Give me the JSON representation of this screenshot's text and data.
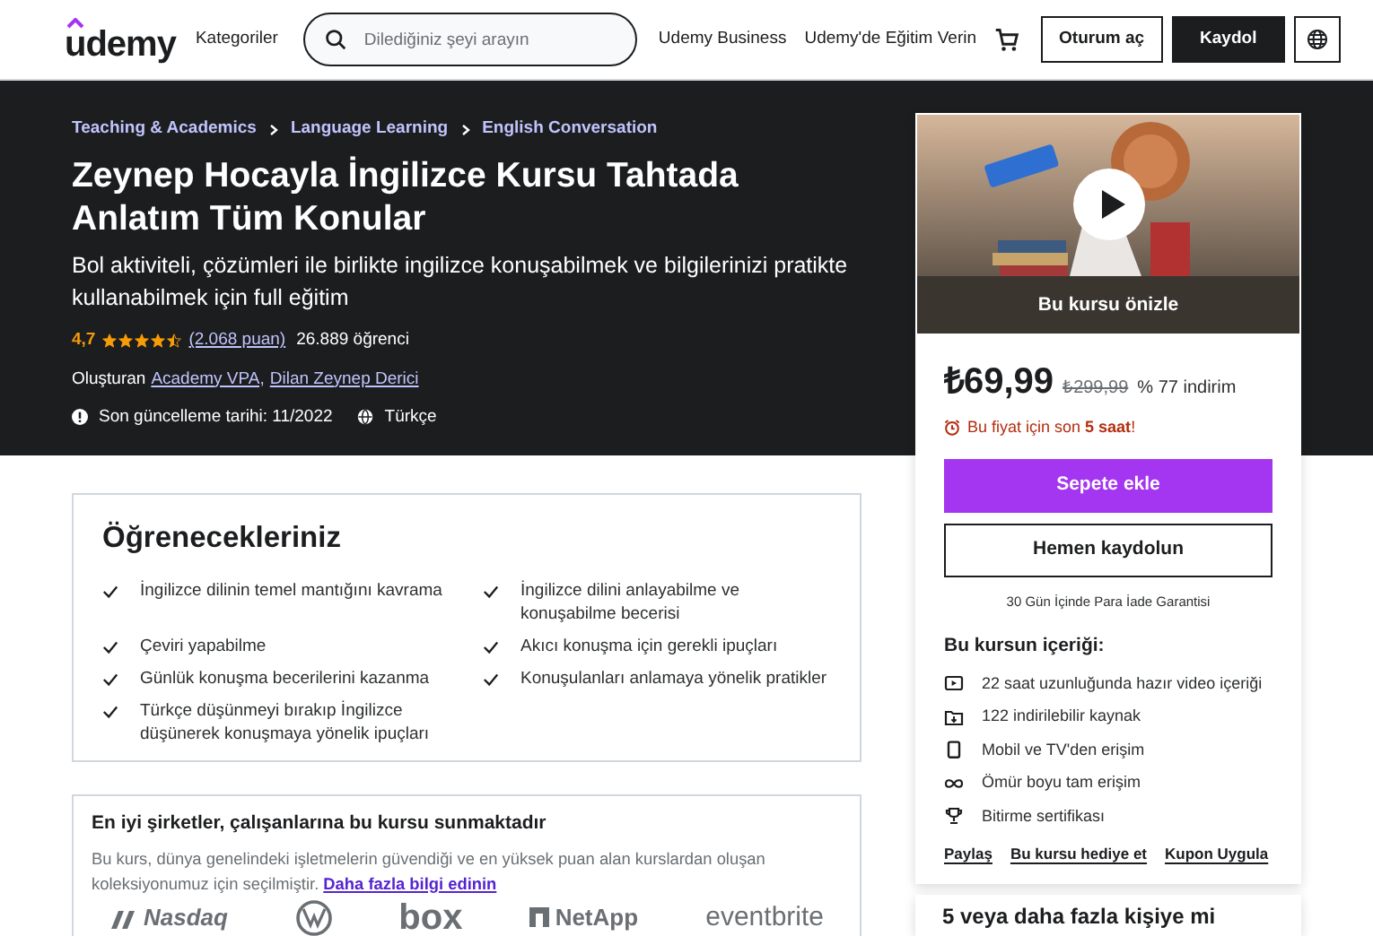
{
  "header": {
    "logo": "udemy",
    "categories": "Kategoriler",
    "search": {
      "placeholder": "Dilediğiniz şeyi arayın"
    },
    "links": [
      "Udemy Business",
      "Udemy'de Eğitim Verin"
    ],
    "login": "Oturum aç",
    "signup": "Kaydol"
  },
  "hero": {
    "breadcrumbs": [
      "Teaching & Academics",
      "Language Learning",
      "English Conversation"
    ],
    "title": "Zeynep Hocayla İngilizce Kursu Tahtada Anlatım Tüm Konular",
    "subtitle": "Bol aktiviteli, çözümleri ile birlikte ingilizce konuşabilmek ve bilgilerinizi pratikte kullanabilmek için full eğitim",
    "rating": "4,7",
    "stars": 4.5,
    "ratings_link": "(2.068 puan)",
    "students": "26.889 öğrenci",
    "created_by": "Oluşturan",
    "authors": [
      "Academy VPA,",
      "Dilan Zeynep Derici"
    ],
    "updated": "Son güncelleme tarihi: 11/2022",
    "language": "Türkçe"
  },
  "sidebar": {
    "preview": {
      "kind": "picture",
      "caption": "Bu kursu önizle"
    },
    "price": "₺69,99",
    "old_price": "₺299,99",
    "discount": "% 77 indirim",
    "timer": {
      "prefix": "Bu fiyat için son ",
      "bold": "5 saat",
      "suffix": "!"
    },
    "add_to_cart": "Sepete ekle",
    "buy_now": "Hemen kaydolun",
    "guarantee": "30 Gün İçinde Para İade Garantisi",
    "includes_title": "Bu kursun içeriği:",
    "includes": [
      {
        "kind": "video",
        "text": "22 saat uzunluğunda hazır video içeriği"
      },
      {
        "kind": "file",
        "text": "122 indirilebilir kaynak"
      },
      {
        "kind": "mobile",
        "text": "Mobil ve TV'den erişim"
      },
      {
        "kind": "infinity",
        "text": "Ömür boyu tam erişim"
      },
      {
        "kind": "trophy",
        "text": "Bitirme sertifikası"
      }
    ],
    "actions": [
      "Paylaş",
      "Bu kursu hediye et",
      "Kupon Uygula"
    ],
    "team_title": "5 veya daha fazla kişiye mi"
  },
  "learn": {
    "title": "Öğrenecekleriniz",
    "items": [
      "İngilizce dilinin temel mantığını kavrama",
      "İngilizce dilini anlayabilme ve konuşabilme becerisi",
      "Çeviri yapabilme",
      "Akıcı konuşma için gerekli ipuçları",
      "Günlük konuşma becerilerini kazanma",
      "Konuşulanları anlamaya yönelik pratikler",
      "Türkçe düşünmeyi bırakıp İngilizce düşünerek konuşmaya yönelik ipuçları"
    ]
  },
  "companies": {
    "title": "En iyi şirketler, çalışanlarına bu kursu sunmaktadır",
    "text": "Bu kurs, dünya genelindeki işletmelerin güvendiği ve en yüksek puan alan kurslardan oluşan koleksiyonumuz için seçilmiştir.",
    "link": "Daha fazla bilgi edinin",
    "logos": [
      {
        "kind": "nasdaq",
        "text": "Nasdaq"
      },
      {
        "kind": "vw"
      },
      {
        "kind": "box",
        "text": "box"
      },
      {
        "kind": "netapp",
        "text": "NetApp"
      },
      {
        "kind": "eventbrite",
        "text": "eventbrite"
      }
    ]
  }
}
